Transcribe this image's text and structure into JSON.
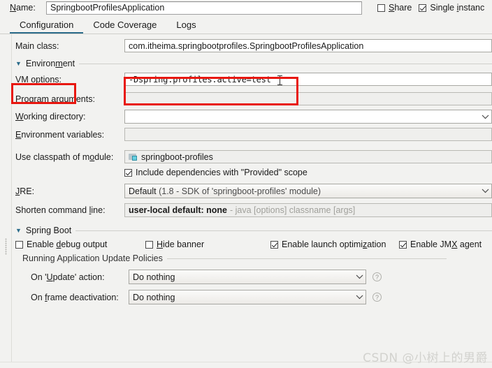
{
  "window": {
    "name_label": "Name:",
    "name_value": "SpringbootProfilesApplication",
    "share_label": "Share",
    "single_instance_label": "Single instanc",
    "accent_color": "#2a6b8a",
    "annotation_color": "#e8170f"
  },
  "tabs": [
    {
      "label": "Configuration",
      "active": true
    },
    {
      "label": "Code Coverage",
      "active": false
    },
    {
      "label": "Logs",
      "active": false
    }
  ],
  "configuration": {
    "main_class": {
      "label": "Main class:",
      "value": "com.itheima.springbootprofiles.SpringbootProfilesApplication"
    },
    "environment_section": "Environment",
    "vm_options": {
      "label": "VM options:",
      "value": "-Dspring.profiles.active=test"
    },
    "program_arguments": {
      "label": "Program arguments:",
      "value": ""
    },
    "working_directory": {
      "label": "Working directory:",
      "value": ""
    },
    "environment_variables": {
      "label": "Environment variables:",
      "value": ""
    },
    "use_classpath_of_module": {
      "label": "Use classpath of module:",
      "value": "springboot-profiles"
    },
    "include_provided": {
      "label": "Include dependencies with \"Provided\" scope",
      "checked": true
    },
    "jre": {
      "label": "JRE:",
      "value": "Default",
      "hint": "(1.8 - SDK of 'springboot-profiles' module)"
    },
    "shorten_command_line": {
      "label": "Shorten command line:",
      "value": "user-local default: none",
      "hint": "- java [options] classname [args]"
    }
  },
  "spring_boot": {
    "section_title": "Spring Boot",
    "checkboxes": [
      {
        "label": "Enable debug output",
        "checked": false
      },
      {
        "label": "Hide banner",
        "checked": false
      },
      {
        "label": "Enable launch optimization",
        "checked": true
      },
      {
        "label": "Enable JMX agent",
        "checked": true
      }
    ],
    "policies_title": "Running Application Update Policies",
    "on_update_action": {
      "label": "On 'Update' action:",
      "value": "Do nothing"
    },
    "on_frame_deactivation": {
      "label": "On frame deactivation:",
      "value": "Do nothing"
    }
  },
  "watermark": "CSDN @小树上的男爵"
}
